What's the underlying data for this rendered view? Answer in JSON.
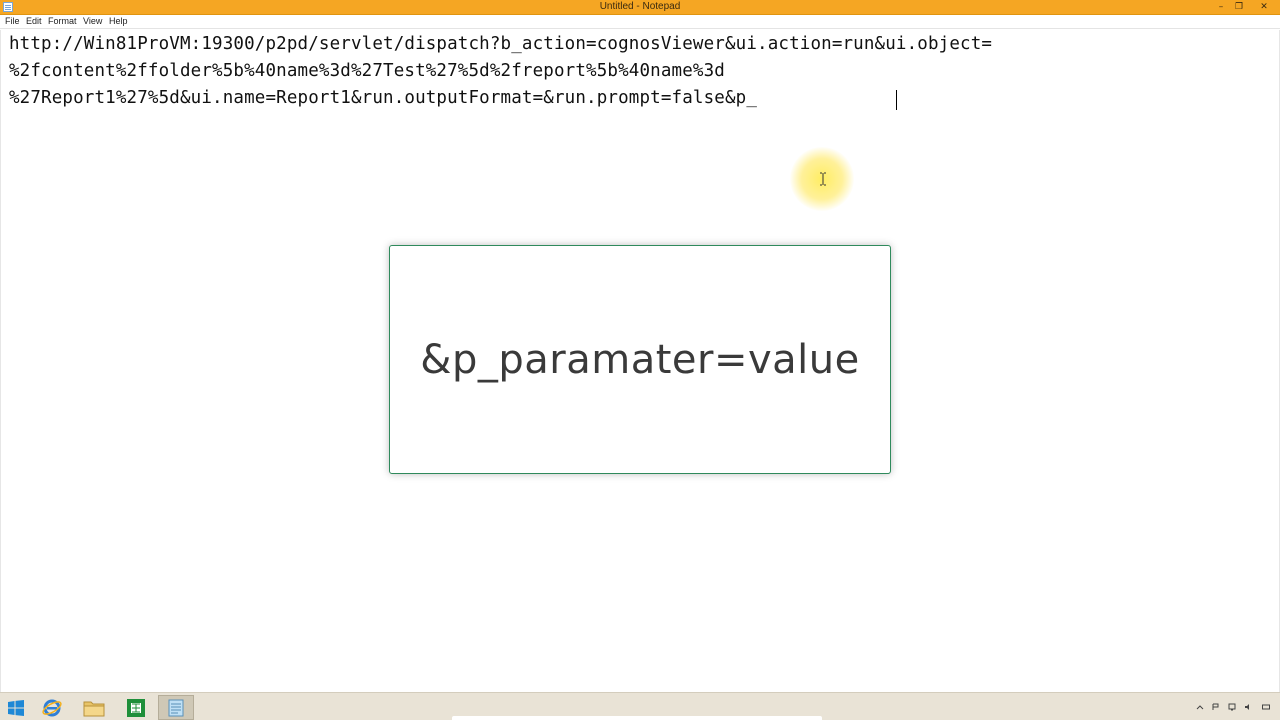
{
  "window": {
    "title": "Untitled - Notepad",
    "min_glyph": "–",
    "max_glyph": "❐",
    "close_glyph": "✕"
  },
  "menu": {
    "file": "File",
    "edit": "Edit",
    "format": "Format",
    "view": "View",
    "help": "Help"
  },
  "editor": {
    "lines": [
      "http://Win81ProVM:19300/p2pd/servlet/dispatch?b_action=cognosViewer&ui.action=run&ui.object=",
      "%2fcontent%2ffolder%5b%40name%3d%27Test%27%5d%2freport%5b%40name%3d",
      "%27Report1%27%5d&ui.name=Report1&run.outputFormat=&run.prompt=false&p_"
    ]
  },
  "overlay": {
    "text": "&p_paramater=value"
  },
  "taskbar": {
    "icons": [
      "windows-start-icon",
      "internet-explorer-icon",
      "file-explorer-icon",
      "excel-icon",
      "notepad-icon"
    ]
  },
  "colors": {
    "titlebar": "#f5a623",
    "overlay_border": "#2f8a5c",
    "cursor_highlight": "#ffec5a",
    "taskbar": "#e9e3d6"
  }
}
